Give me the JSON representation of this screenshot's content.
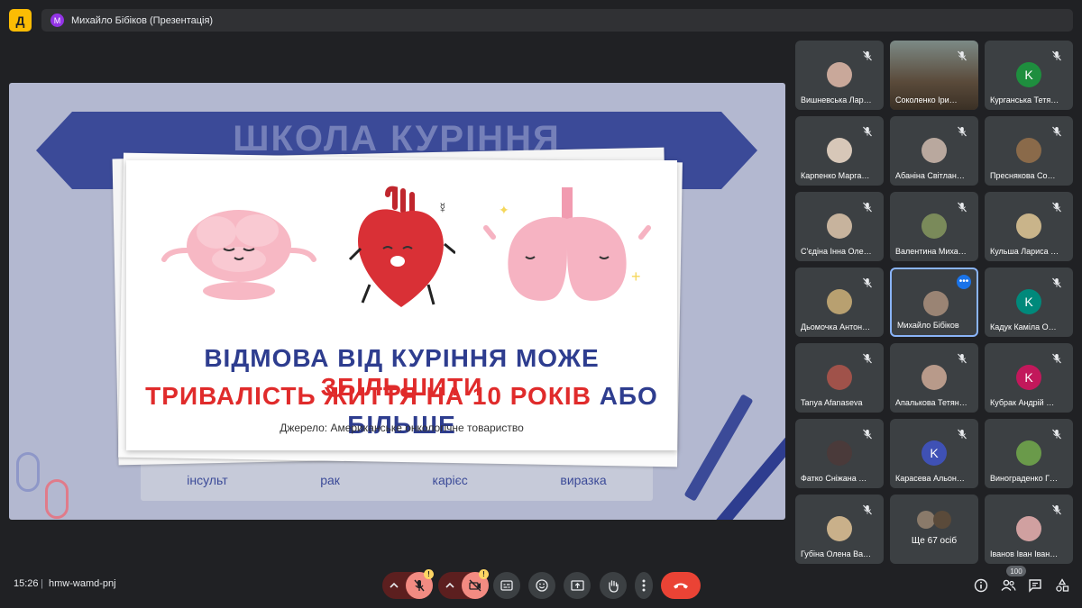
{
  "app": {
    "logo_letter": "Д"
  },
  "presenter": {
    "avatar_letter": "М",
    "label": "Михайло Бібіков (Презентація)"
  },
  "slide": {
    "banner_title": "ШКОЛА КУРІННЯ",
    "line1_blue_a": "ВІДМОВА ВІД КУРІННЯ МОЖЕ ",
    "line1_red": "ЗБІЛЬШИТИ",
    "line2_red": "ТРИВАЛІСТЬ ЖИТТЯ НА 10 РОКІВ",
    "line2_blue": " АБО БІЛЬШЕ",
    "source": "Джерело: Американське онкологічне товариство",
    "strip_words": [
      "інсульт",
      "рак",
      "карієс",
      "виразка"
    ]
  },
  "participants": [
    {
      "name": "Вишневська Лар…",
      "type": "face",
      "color": "#c9a89a"
    },
    {
      "name": "Соколенко Іри…",
      "type": "photo"
    },
    {
      "name": "Курганська Тетя…",
      "type": "letter",
      "letter": "K",
      "color": "#1e8e3e"
    },
    {
      "name": "Карпенко Марга…",
      "type": "face",
      "color": "#d7c7b8"
    },
    {
      "name": "Абаніна Світлан…",
      "type": "face",
      "color": "#b9a89e"
    },
    {
      "name": "Преснякова Со…",
      "type": "face",
      "color": "#8a6a4a"
    },
    {
      "name": "С'єдіна Інна Оле…",
      "type": "face",
      "color": "#c7b39d"
    },
    {
      "name": "Валентина Миха…",
      "type": "face",
      "color": "#7a8a5a"
    },
    {
      "name": "Кульша Лариса …",
      "type": "face",
      "color": "#c9b48a"
    },
    {
      "name": "Дьомочка Антон…",
      "type": "face",
      "color": "#b8a070"
    },
    {
      "name": "Михайло Бібіков",
      "type": "face",
      "color": "#9a8474",
      "active": true
    },
    {
      "name": "Кадук Каміла О…",
      "type": "letter",
      "letter": "K",
      "color": "#00897b"
    },
    {
      "name": "Tanya Afanaseva",
      "type": "face",
      "color": "#a0524a"
    },
    {
      "name": "Апалькова Тетян…",
      "type": "face",
      "color": "#b89a8a"
    },
    {
      "name": "Кубрак Андрій …",
      "type": "letter",
      "letter": "K",
      "color": "#c2185b"
    },
    {
      "name": "Фатко Сніжана …",
      "type": "face",
      "color": "#4a3a3a"
    },
    {
      "name": "Карасева Альон…",
      "type": "letter",
      "letter": "K",
      "color": "#3f51b5"
    },
    {
      "name": "Винограденко Г…",
      "type": "face",
      "color": "#6a9a4a"
    },
    {
      "name": "Губіна Олена Ва…",
      "type": "face",
      "color": "#c9b08a"
    },
    {
      "name": "Ще 67 осіб",
      "type": "more"
    },
    {
      "name": "Іванов Іван Іван…",
      "type": "face",
      "color": "#d0a0a0"
    }
  ],
  "footer": {
    "time": "15:26",
    "separator": "|",
    "meeting_code": "hmw-wamd-pnj",
    "people_count": "100",
    "warn_mark": "!"
  },
  "colors": {
    "end_call": "#ea4335",
    "accent": "#8ab4f8",
    "slide_blue": "#2e3d8f",
    "slide_red": "#e02b2b"
  }
}
